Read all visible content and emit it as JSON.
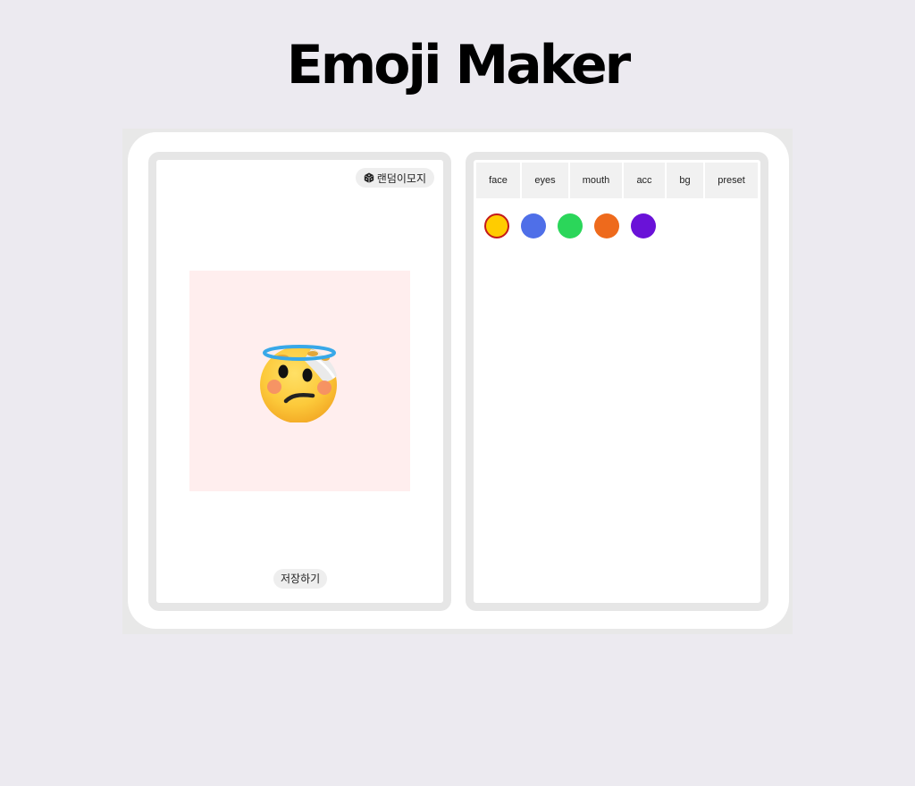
{
  "header": {
    "title": "Emoji Maker"
  },
  "preview": {
    "random_label": "랜덤이모지",
    "random_icon": "dice-icon",
    "save_label": "저장하기",
    "canvas_background": "#ffeeee"
  },
  "editor": {
    "tabs": [
      {
        "label": "face"
      },
      {
        "label": "eyes"
      },
      {
        "label": "mouth"
      },
      {
        "label": "acc"
      },
      {
        "label": "bg"
      },
      {
        "label": "preset"
      }
    ],
    "active_tab": "face",
    "colors": [
      {
        "name": "yellow",
        "hex": "#ffcc00",
        "selected": true
      },
      {
        "name": "blue",
        "hex": "#4f6fe8",
        "selected": false
      },
      {
        "name": "green",
        "hex": "#2bd65a",
        "selected": false
      },
      {
        "name": "orange",
        "hex": "#ee6a1c",
        "selected": false
      },
      {
        "name": "purple",
        "hex": "#6a12d8",
        "selected": false
      }
    ]
  }
}
